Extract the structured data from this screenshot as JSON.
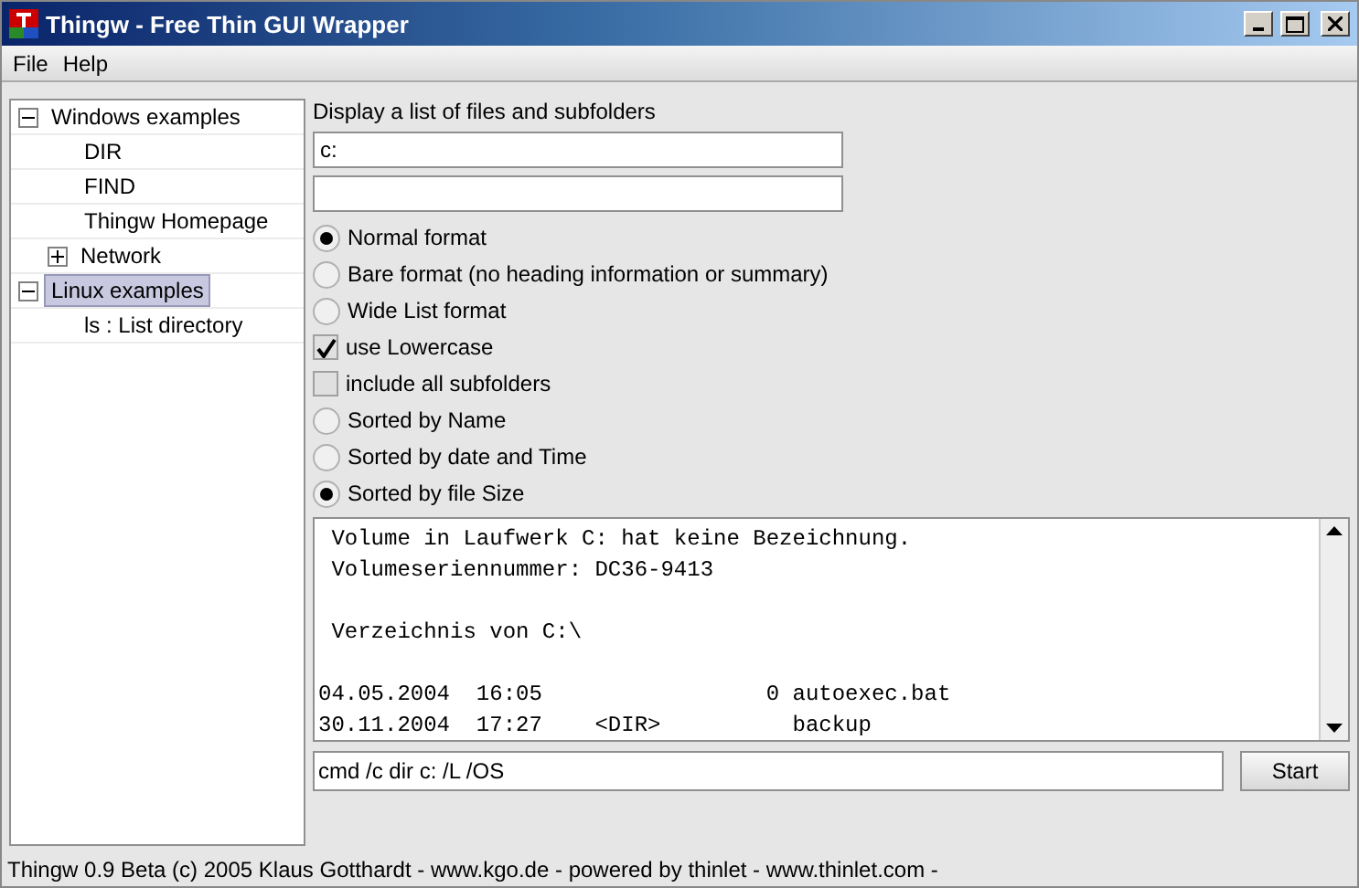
{
  "window": {
    "title": "Thingw - Free Thin GUI Wrapper"
  },
  "menu": [
    "File",
    "Help"
  ],
  "tree": [
    {
      "label": "Windows examples",
      "expanded": true,
      "selected": false,
      "children": [
        {
          "label": "DIR",
          "selected": false
        },
        {
          "label": "FIND",
          "selected": false
        },
        {
          "label": "Thingw Homepage",
          "selected": false
        },
        {
          "label": "Network",
          "selected": false,
          "expanded": false
        }
      ]
    },
    {
      "label": "Linux examples",
      "expanded": true,
      "selected": true,
      "children": [
        {
          "label": "ls : List directory",
          "selected": false
        }
      ]
    }
  ],
  "heading": "Display a list of files and subfolders",
  "fields": [
    {
      "kind": "text",
      "value": "c:"
    },
    {
      "kind": "text"
    }
  ],
  "options": [
    {
      "kind": "radio",
      "label": "Normal format",
      "checked": true
    },
    {
      "kind": "radio",
      "label": "Bare format (no heading information or summary)",
      "checked": false
    },
    {
      "kind": "radio",
      "label": "Wide List format",
      "checked": false
    },
    {
      "kind": "checkbox",
      "label": "use Lowercase",
      "checked": true
    },
    {
      "kind": "checkbox",
      "label": "include all subfolders",
      "checked": false
    },
    {
      "kind": "radio",
      "label": "Sorted by Name",
      "checked": false
    },
    {
      "kind": "radio",
      "label": "Sorted by date and Time",
      "checked": false
    },
    {
      "kind": "radio",
      "label": "Sorted by file Size",
      "checked": true
    }
  ],
  "output": " Volume in Laufwerk C: hat keine Bezeichnung.\n Volumeseriennummer: DC36-9413\n\n Verzeichnis von C:\\\n\n04.05.2004  16:05                 0 autoexec.bat\n30.11.2004  17:27    <DIR>          backup",
  "command": {
    "value": "cmd /c dir c: /L /OS"
  },
  "start_button": "Start",
  "status_bar": "Thingw 0.9 Beta (c) 2005 Klaus Gotthardt - www.kgo.de -  powered by thinlet - www.thinlet.com -"
}
